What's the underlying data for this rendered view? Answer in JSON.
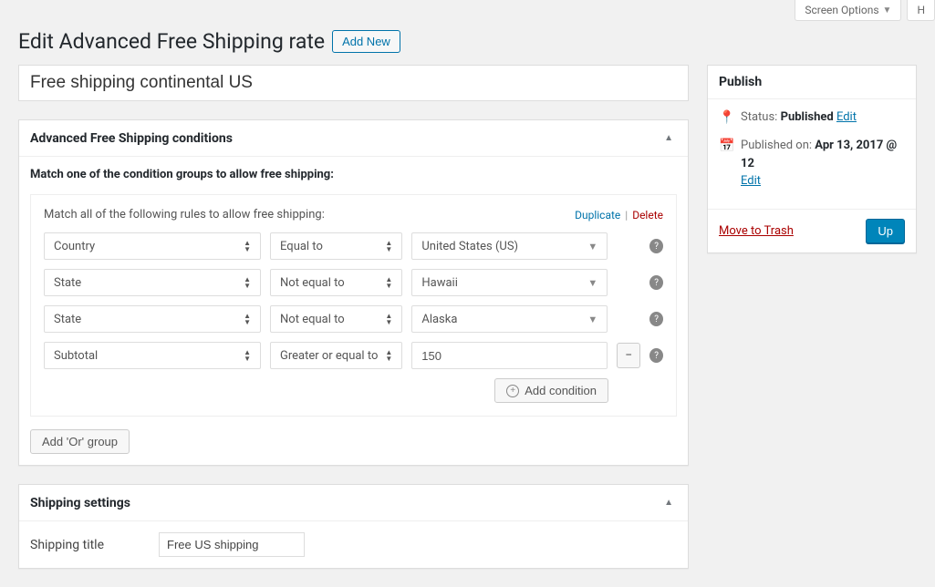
{
  "topbar": {
    "screen_options": "Screen Options",
    "help": "H"
  },
  "header": {
    "title": "Edit Advanced Free Shipping rate",
    "add_new": "Add New"
  },
  "post_title": "Free shipping continental US",
  "conditions": {
    "box_title": "Advanced Free Shipping conditions",
    "match_intro": "Match one of the condition groups to allow free shipping:",
    "group_desc": "Match all of the following rules to allow free shipping:",
    "duplicate": "Duplicate",
    "delete": "Delete",
    "rules": [
      {
        "field": "Country",
        "op": "Equal to",
        "value": "United States (US)",
        "value_kind": "select"
      },
      {
        "field": "State",
        "op": "Not equal to",
        "value": "Hawaii",
        "value_kind": "select"
      },
      {
        "field": "State",
        "op": "Not equal to",
        "value": "Alaska",
        "value_kind": "select"
      },
      {
        "field": "Subtotal",
        "op": "Greater or equal to",
        "value": "150",
        "value_kind": "input"
      }
    ],
    "add_condition": "Add condition",
    "add_or_group": "Add 'Or' group"
  },
  "shipping_settings": {
    "box_title": "Shipping settings",
    "shipping_title_label": "Shipping title",
    "shipping_title_value": "Free US shipping"
  },
  "publish": {
    "box_title": "Publish",
    "status_label": "Status:",
    "status_value": "Published",
    "edit": "Edit",
    "published_on_label": "Published on:",
    "published_on_value": "Apr 13, 2017 @ 12",
    "move_to_trash": "Move to Trash",
    "update": "Up"
  }
}
